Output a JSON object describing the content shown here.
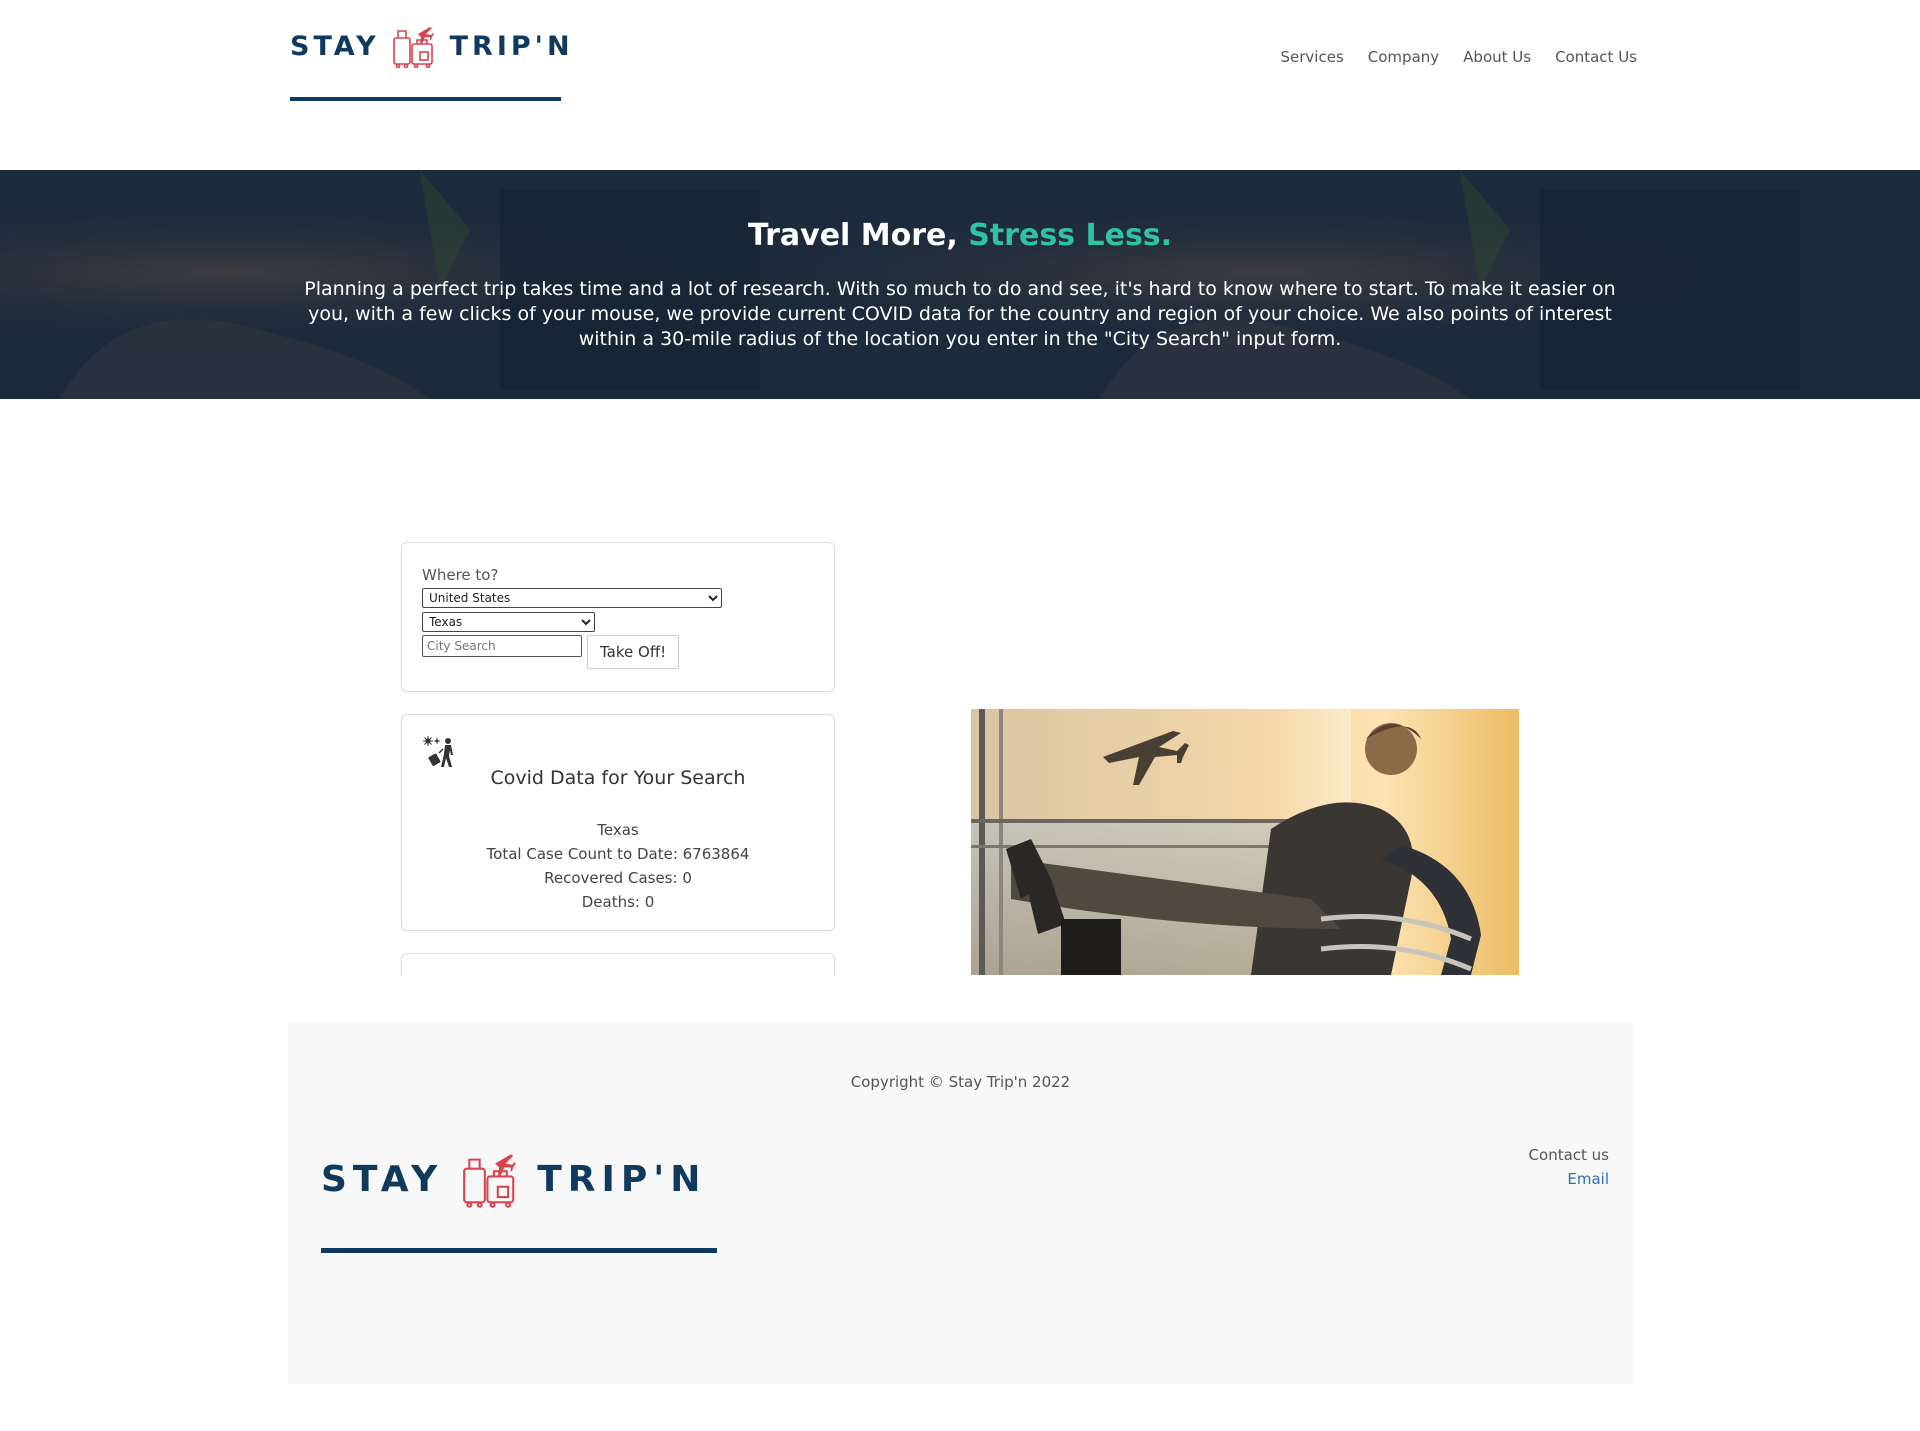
{
  "brand": {
    "left_word": "STAY",
    "right_word": "TRIP'N"
  },
  "nav": {
    "items": [
      "Services",
      "Company",
      "About Us",
      "Contact Us"
    ]
  },
  "hero": {
    "title_main": "Travel More, ",
    "title_accent": "Stress Less.",
    "description": "Planning a perfect trip takes time and a lot of research. With so much to do and see, it's hard to know where to start. To make it easier on you, with a few clicks of your mouse, we provide current COVID data for the country and region of your choice. We also points of interest within a 30-mile radius of the location you enter in the \"City Search\" input form."
  },
  "search": {
    "label": "Where to?",
    "country": "United States",
    "state": "Texas",
    "city_placeholder": "City Search",
    "city_value": "",
    "button": "Take Off!"
  },
  "covid": {
    "title": "Covid Data for Your Search",
    "location": "Texas",
    "total_cases": "Total Case Count to Date: 6763864",
    "recovered": "Recovered Cases: 0",
    "deaths": "Deaths: 0"
  },
  "footer": {
    "copyright": "Copyright © Stay Trip'n 2022",
    "contact_label": "Contact us",
    "email_label": "Email"
  },
  "colors": {
    "brand_navy": "#10395e",
    "accent_teal": "#2ec4a1",
    "logo_red": "#d9434e",
    "link_blue": "#2f6db5"
  }
}
